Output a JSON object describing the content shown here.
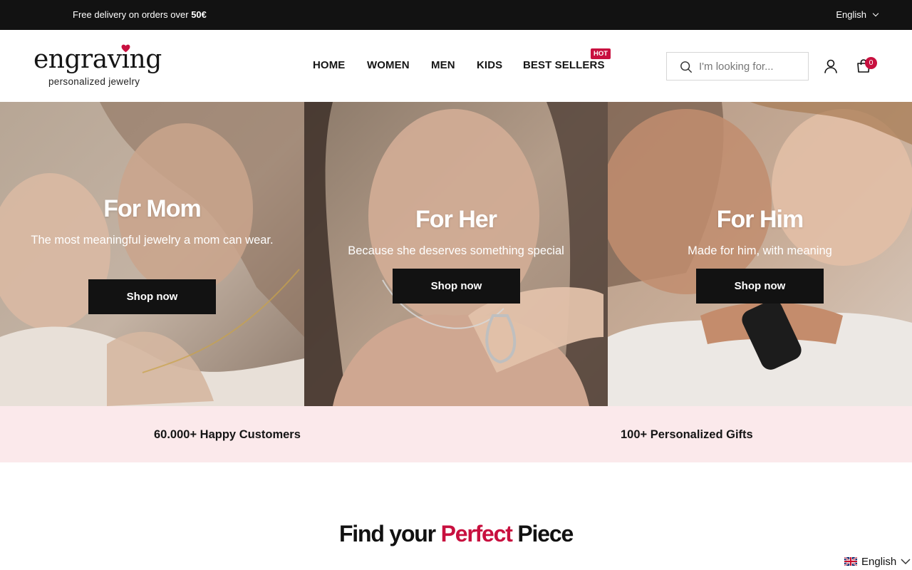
{
  "announcement": {
    "text": "Free delivery on orders over ",
    "amount": "50€",
    "language": "English"
  },
  "header": {
    "logo": {
      "name": "engraving",
      "tagline": "personalized jewelry"
    },
    "nav": [
      {
        "label": "HOME"
      },
      {
        "label": "WOMEN"
      },
      {
        "label": "MEN"
      },
      {
        "label": "KIDS"
      },
      {
        "label": "BEST SELLERS",
        "badge": "HOT"
      }
    ],
    "search_placeholder": "I'm looking for...",
    "cart_count": "0"
  },
  "hero": [
    {
      "title": "For Mom",
      "subtitle": "The most meaningful jewelry a mom can wear.",
      "button": "Shop now"
    },
    {
      "title": "For Her",
      "subtitle": "Because she deserves something special",
      "button": "Shop now"
    },
    {
      "title": "For Him",
      "subtitle": "Made for him, with meaning",
      "button": "Shop now"
    }
  ],
  "stats": [
    {
      "label": "60.000+ Happy Customers"
    },
    {
      "label": "100+ Personalized Gifts"
    }
  ],
  "headline": {
    "before": "Find your ",
    "accent": "Perfect",
    "after": " Piece"
  },
  "floating_language": {
    "label": "English"
  },
  "colors": {
    "accent": "#c8103f",
    "dark": "#121212",
    "stats_bg": "#fbe9eb"
  }
}
